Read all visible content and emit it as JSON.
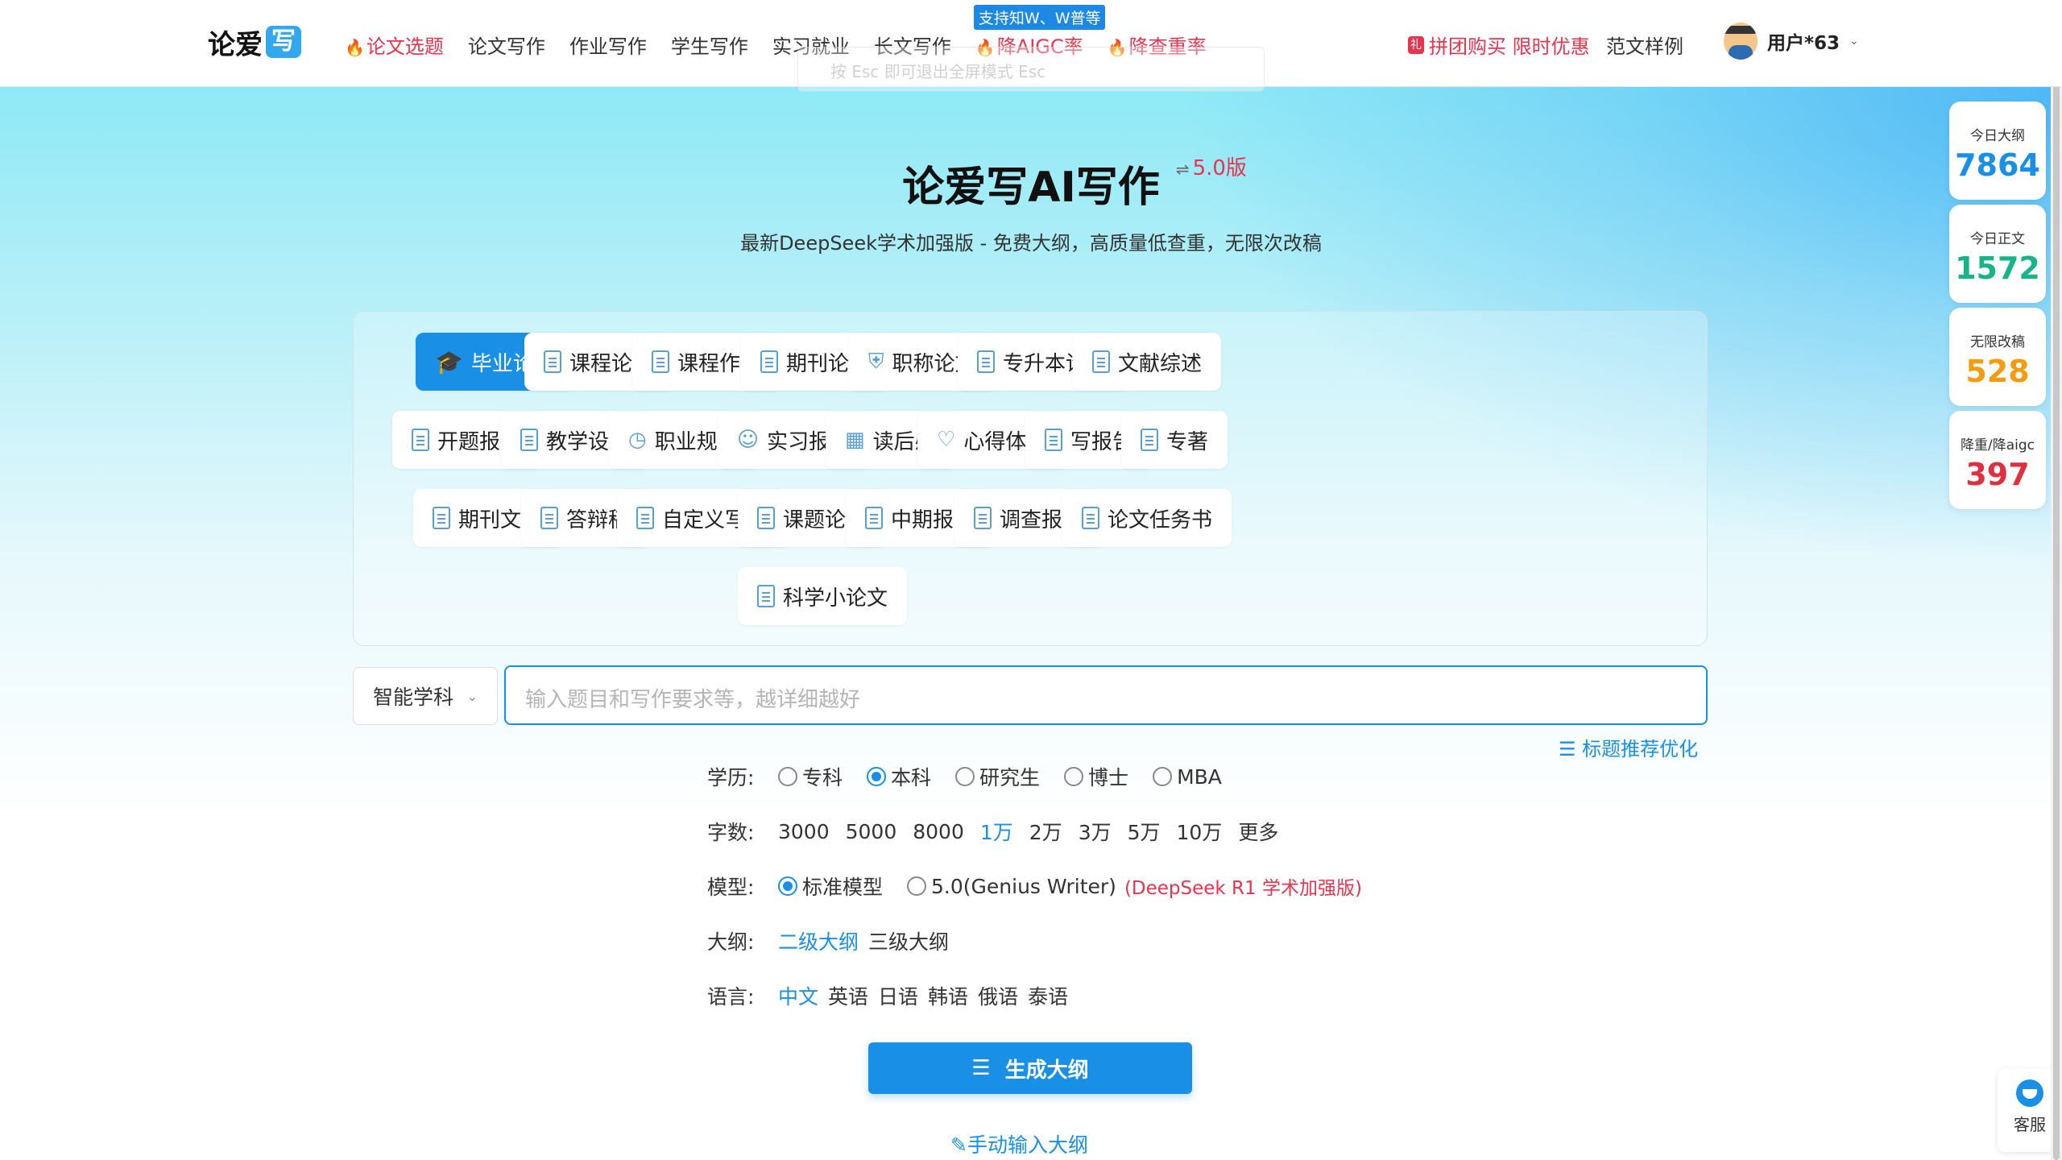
{
  "header": {
    "logo_text": "论爱",
    "logo_badge": "写",
    "nav": [
      {
        "label": "论文选题",
        "hot": true
      },
      {
        "label": "论文写作",
        "hot": false
      },
      {
        "label": "作业写作",
        "hot": false
      },
      {
        "label": "学生写作",
        "hot": false
      },
      {
        "label": "实习就业",
        "hot": false
      },
      {
        "label": "长文写作",
        "hot": false
      },
      {
        "label": "降AIGC率",
        "hot": true
      },
      {
        "label": "降查重率",
        "hot": true
      }
    ],
    "nav_tag": "支持知W、W普等",
    "esc_hint": "按 Esc 即可退出全屏模式   Esc",
    "promo": "拼团购买 限时优惠",
    "samples": "范文样例",
    "user_name": "用户*63"
  },
  "hero": {
    "title": "论爱写AI写作",
    "version": "5.0版",
    "subtitle": "最新DeepSeek学术加强版 - 免费大纲，高质量低查重，无限次改稿"
  },
  "types": [
    "毕业论文",
    "课程论文",
    "课程作业",
    "期刊论文",
    "职称论文",
    "专升本论文",
    "文献综述",
    "开题报告",
    "教学设计",
    "职业规划",
    "实习报告",
    "读后感",
    "心得体会",
    "写报告",
    "专著",
    "期刊文章",
    "答辩稿",
    "自定义写作",
    "课题论文",
    "中期报告",
    "调查报告",
    "论文任务书",
    "科学小论文"
  ],
  "subject_select": "智能学科",
  "topic_placeholder": "输入题目和写作要求等，越详细越好",
  "recommend": "标题推荐优化",
  "options": {
    "education": {
      "label": "学历:",
      "items": [
        "专科",
        "本科",
        "研究生",
        "博士",
        "MBA"
      ],
      "selected": "本科"
    },
    "words": {
      "label": "字数:",
      "items": [
        "3000",
        "5000",
        "8000",
        "1万",
        "2万",
        "3万",
        "5万",
        "10万",
        "更多"
      ],
      "selected": "1万"
    },
    "model": {
      "label": "模型:",
      "items": [
        "标准模型",
        "5.0(Genius Writer)"
      ],
      "selected": "标准模型",
      "note": "(DeepSeek R1 学术加强版)"
    },
    "outline": {
      "label": "大纲:",
      "items": [
        "二级大纲",
        "三级大纲"
      ],
      "selected": "二级大纲"
    },
    "language": {
      "label": "语言:",
      "items": [
        "中文",
        "英语",
        "日语",
        "韩语",
        "俄语",
        "泰语"
      ],
      "selected": "中文"
    }
  },
  "generate_button": "生成大纲",
  "manual_link": "手动输入大纲",
  "stats": [
    {
      "label": "今日大纲",
      "value": "7864",
      "color": "#1a8fe6"
    },
    {
      "label": "今日正文",
      "value": "1572",
      "color": "#19b38a"
    },
    {
      "label": "无限改稿",
      "value": "528",
      "color": "#f39c12"
    },
    {
      "label": "降重/降aigc",
      "value": "397",
      "color": "#e0303f"
    }
  ],
  "service_label": "客服"
}
